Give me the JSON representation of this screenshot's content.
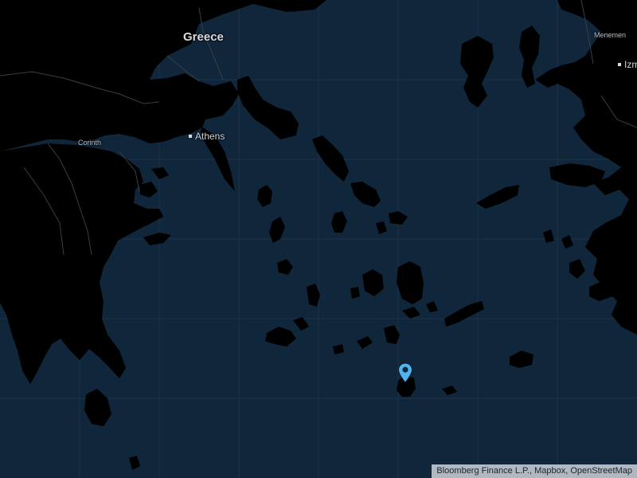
{
  "map": {
    "colors": {
      "sea": "#10263b",
      "land": "#000000",
      "border": "#3a3f45",
      "pin": "#4fb5f0"
    },
    "labels": {
      "country_greece": "Greece",
      "city_athens": "Athens",
      "city_corinth": "Corinth",
      "city_menemen": "Menemen",
      "city_izmir": "Izm"
    },
    "marker": {
      "icon": "map-pin-icon"
    },
    "attribution": "Bloomberg Finance L.P., Mapbox, OpenStreetMap"
  }
}
